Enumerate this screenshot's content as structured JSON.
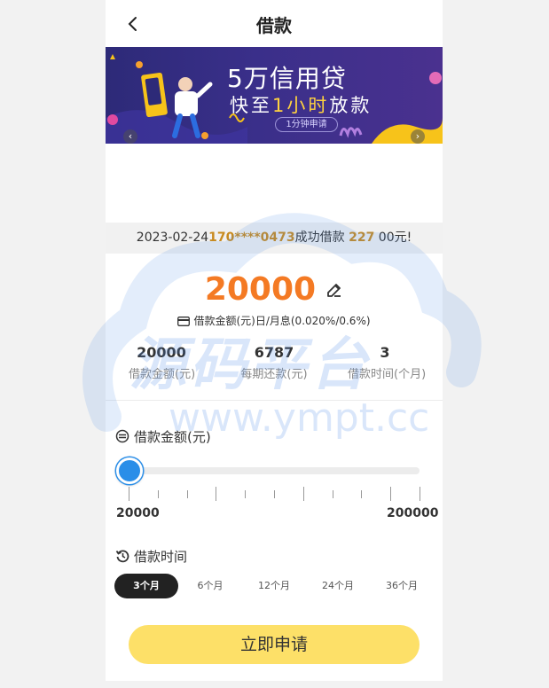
{
  "header": {
    "title": "借款"
  },
  "banner": {
    "line1": "5万信用贷",
    "line2_pre": "快至",
    "line2_hl": "1小时",
    "line2_post": "放款",
    "badge": "1分钟申请"
  },
  "notice": {
    "date": "2023-02-24",
    "phone": "170****0473",
    "mid": "成功借款",
    "amount": "227",
    "suffix": "00元!"
  },
  "loan": {
    "amount": "20000",
    "interest_label": "借款金额(元)日/月息(0.020%/0.6%)"
  },
  "stats": [
    {
      "value": "20000",
      "label": "借款金额(元)"
    },
    {
      "value": "6787",
      "label": "每期还款(元)"
    },
    {
      "value": "3",
      "label": "借款时间(个月)"
    }
  ],
  "amount_section": {
    "title": "借款金额(元)"
  },
  "slider": {
    "min_label": "20000",
    "max_label": "200000",
    "value_fraction": 0.0
  },
  "term_section": {
    "title": "借款时间"
  },
  "terms": [
    {
      "label": "3个月",
      "active": true
    },
    {
      "label": "6个月",
      "active": false
    },
    {
      "label": "12个月",
      "active": false
    },
    {
      "label": "24个月",
      "active": false
    },
    {
      "label": "36个月",
      "active": false
    }
  ],
  "apply": {
    "label": "立即申请"
  },
  "watermark": {
    "cn": "源码平台",
    "url": "www.ympt.cc"
  },
  "colors": {
    "accent": "#f47a24",
    "button": "#fde068",
    "slider": "#2a8ee8"
  }
}
